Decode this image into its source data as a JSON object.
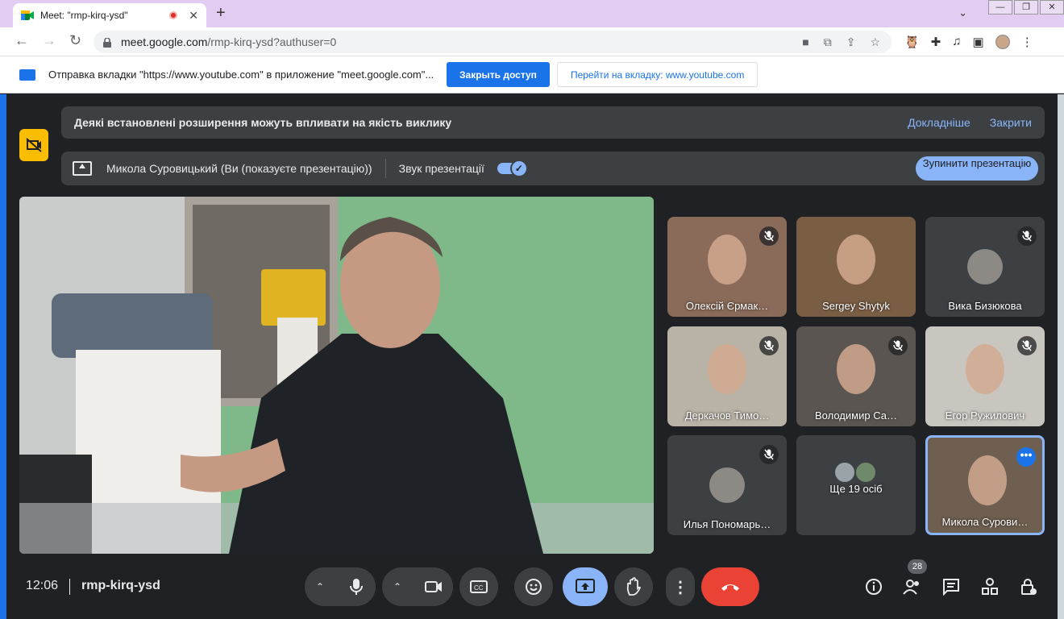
{
  "browser": {
    "tab_title": "Meet: \"rmp-kirq-ysd\"",
    "url_host": "meet.google.com",
    "url_path": "/rmp-kirq-ysd?authuser=0"
  },
  "infobar": {
    "message": "Отправка вкладки \"https://www.youtube.com\" в приложение \"meet.google.com\"...",
    "stop_sharing_label": "Закрыть доступ",
    "switch_tab_label": "Перейти на вкладку: www.youtube.com"
  },
  "extension_banner": {
    "text": "Деякі встановлені розширення можуть впливати на якість виклику",
    "learn_more": "Докладніше",
    "close": "Закрити"
  },
  "presentation_banner": {
    "presenter": "Микола Суровицький (Ви (показуєте презентацію))",
    "audio_label": "Звук презентації",
    "audio_on": true,
    "stop_label": "Зупинити презентацію"
  },
  "participants": [
    {
      "name": "Олексій Єрмак…",
      "muted": true,
      "color": "#8a6a58"
    },
    {
      "name": "Sergey Shytyk",
      "muted": false,
      "color": "#7a5e44"
    },
    {
      "name": "Вика Бизюкова",
      "muted": true,
      "color": "#3c4043",
      "avatar": true
    },
    {
      "name": "Деркачов Тимо…",
      "muted": true,
      "color": "#b9b2a6"
    },
    {
      "name": "Володимир Са…",
      "muted": true,
      "color": "#5a5550"
    },
    {
      "name": "Егор Ружилович",
      "muted": true,
      "color": "#c9c6bf"
    },
    {
      "name": "Илья Пономарь…",
      "muted": true,
      "color": "#3c4043",
      "avatar": true
    },
    {
      "name": "Ще 19 осіб",
      "muted": false,
      "color": "#3c4043",
      "group": true
    },
    {
      "name": "Микола Сурови…",
      "muted": false,
      "color": "#6e5f50",
      "self": true
    }
  ],
  "footer": {
    "time": "12:06",
    "meeting_code": "rmp-kirq-ysd",
    "people_count": "28"
  },
  "icons": {
    "mic": "mic-icon",
    "camera": "camera-icon",
    "captions": "captions-icon",
    "emoji": "emoji-icon",
    "present": "present-icon",
    "hand": "raise-hand-icon",
    "more": "more-vert-icon",
    "end_call": "end-call-icon",
    "info": "info-icon",
    "people": "people-icon",
    "chat": "chat-icon",
    "activities": "activities-icon",
    "host_controls": "lock-person-icon"
  }
}
